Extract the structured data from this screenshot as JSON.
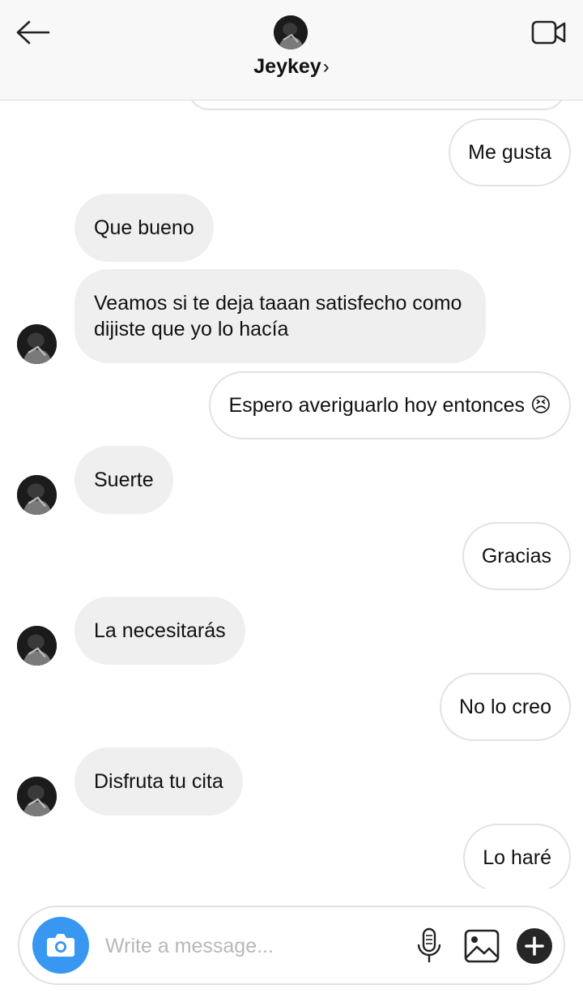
{
  "header": {
    "contact_name": "Jeykey",
    "chevron": "›",
    "back_icon": "arrow-left-icon",
    "video_icon": "video-camera-icon"
  },
  "messages": [
    {
      "from": "me",
      "text": "Me gusta"
    },
    {
      "from": "them",
      "text": "Que bueno"
    },
    {
      "from": "them",
      "text": "Veamos si te deja taaan satisfecho como dijiste que yo lo hacía"
    },
    {
      "from": "me",
      "text": "Espero averiguarlo hoy entonces 😣"
    },
    {
      "from": "them",
      "text": "Suerte"
    },
    {
      "from": "me",
      "text": "Gracias"
    },
    {
      "from": "them",
      "text": "La necesitarás"
    },
    {
      "from": "me",
      "text": "No lo creo"
    },
    {
      "from": "them",
      "text": "Disfruta tu cita"
    },
    {
      "from": "me",
      "text": "Lo haré"
    }
  ],
  "composer": {
    "placeholder": "Write a message...",
    "camera_icon": "camera-icon",
    "mic_icon": "microphone-icon",
    "gallery_icon": "image-icon",
    "plus_icon": "plus-icon"
  },
  "colors": {
    "accent": "#3897f0",
    "their_bubble": "#efefef",
    "my_bubble_border": "#e2e2e2"
  }
}
